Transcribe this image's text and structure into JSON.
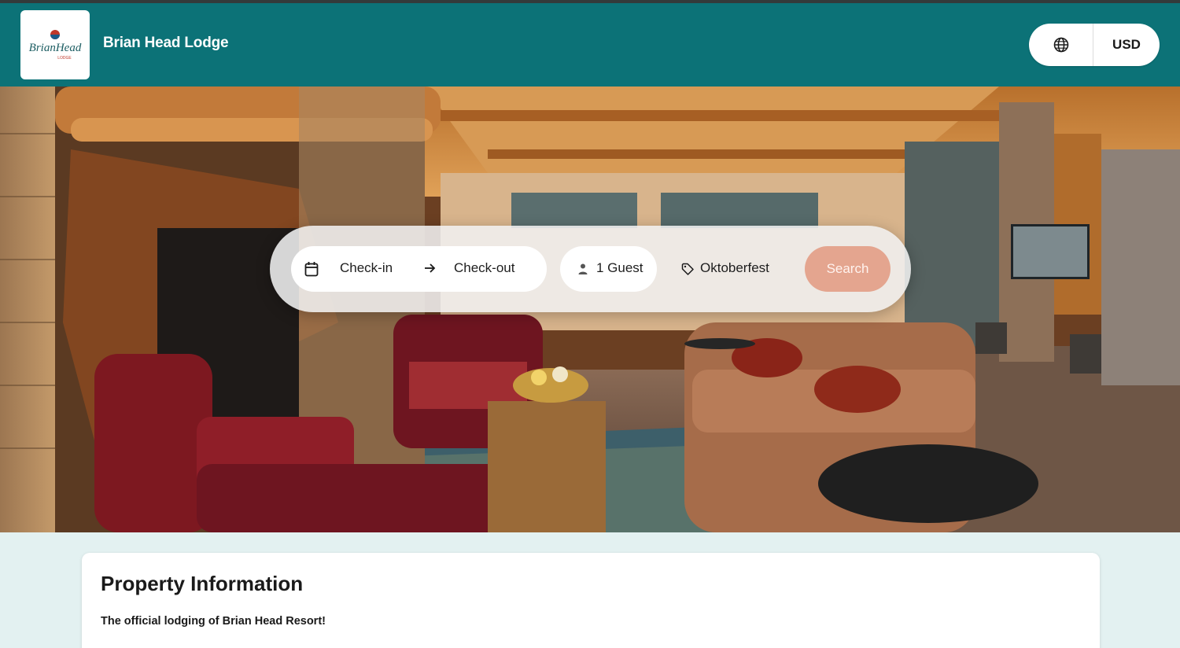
{
  "header": {
    "logo_text": "BrianHead",
    "logo_subtext": "LODGE",
    "site_name": "Brian Head Lodge",
    "language_icon": "globe-icon",
    "currency": "USD"
  },
  "search": {
    "checkin_label": "Check-in",
    "checkout_label": "Check-out",
    "guests_label": "1 Guest",
    "promo_label": "Oktoberfest",
    "search_button": "Search",
    "icons": {
      "calendar": "calendar-icon",
      "arrow": "arrow-right-icon",
      "guest": "person-icon",
      "promo": "tag-icon"
    }
  },
  "property": {
    "title": "Property Information",
    "tagline": "The official lodging of Brian Head Resort!"
  },
  "colors": {
    "header_bg": "#0c7277",
    "search_button_bg": "#e4a58f",
    "page_bg": "#e3f1f1"
  }
}
